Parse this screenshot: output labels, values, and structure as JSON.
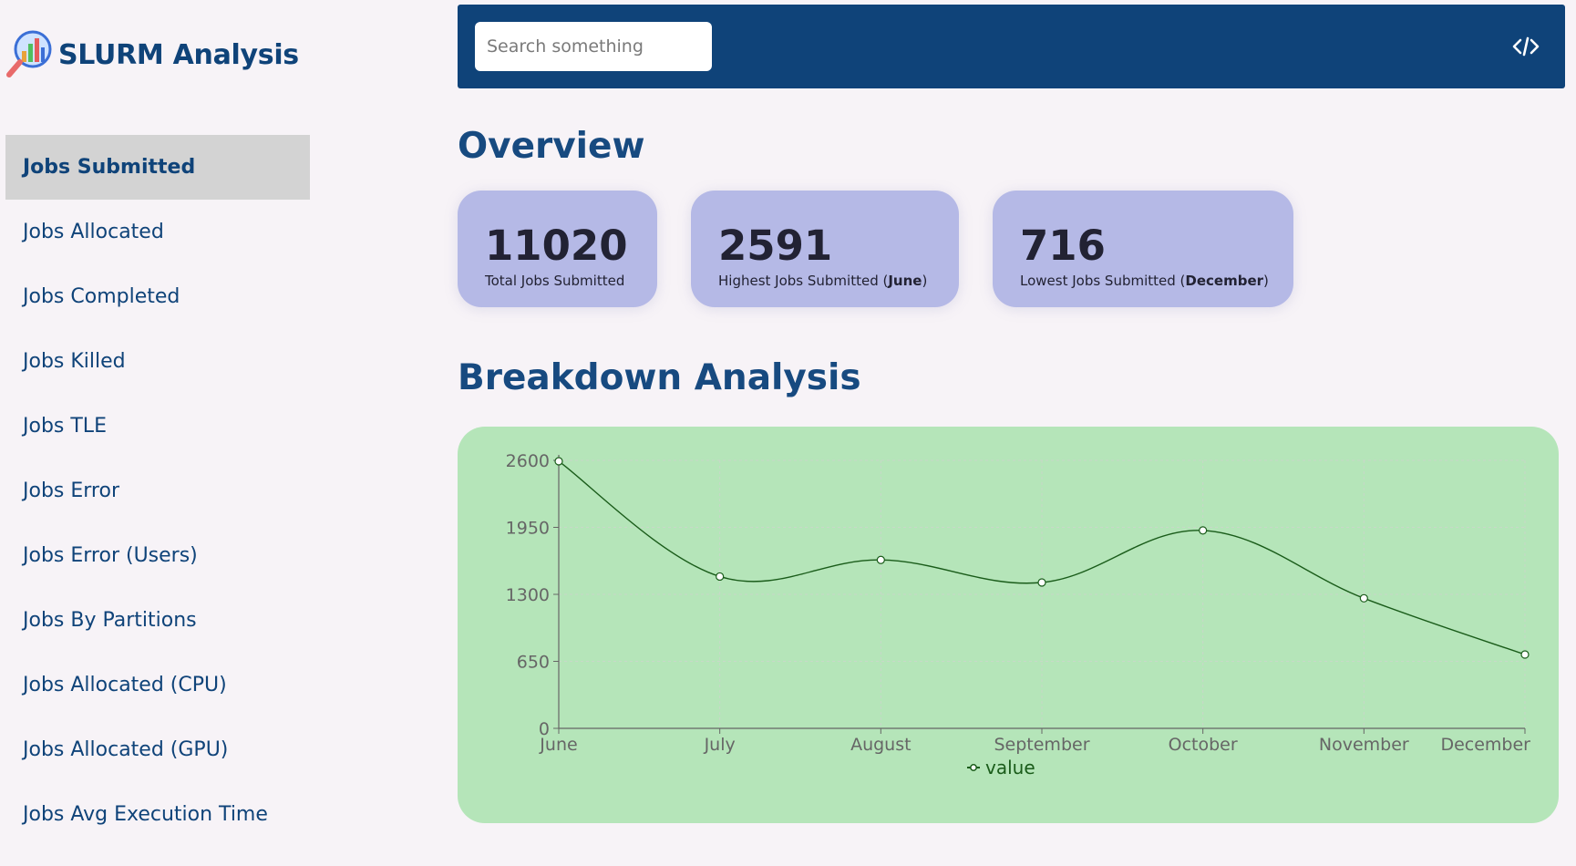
{
  "app": {
    "title": "SLURM Analysis",
    "logo_icon": "analytics-magnifier-icon"
  },
  "sidebar": {
    "items": [
      {
        "label": "Jobs Submitted",
        "active": true
      },
      {
        "label": "Jobs Allocated"
      },
      {
        "label": "Jobs Completed"
      },
      {
        "label": "Jobs Killed"
      },
      {
        "label": "Jobs TLE"
      },
      {
        "label": "Jobs Error"
      },
      {
        "label": "Jobs Error (Users)"
      },
      {
        "label": "Jobs By Partitions"
      },
      {
        "label": "Jobs Allocated (CPU)"
      },
      {
        "label": "Jobs Allocated (GPU)"
      },
      {
        "label": "Jobs Avg Execution Time"
      }
    ]
  },
  "header": {
    "search_placeholder": "Search something",
    "code_icon": "code-icon"
  },
  "overview": {
    "title": "Overview",
    "cards": [
      {
        "value": "11020",
        "label": "Total Jobs Submitted",
        "label_emph": ""
      },
      {
        "value": "2591",
        "label": "Highest Jobs Submitted",
        "label_emph": "June"
      },
      {
        "value": "716",
        "label": "Lowest Jobs Submitted",
        "label_emph": "December"
      }
    ]
  },
  "breakdown": {
    "title": "Breakdown Analysis"
  },
  "colors": {
    "brand": "#0f4379",
    "card_bg": "#b5b9e6",
    "chart_bg": "#b5e5b9",
    "line": "#1a5c1a"
  },
  "chart_data": {
    "type": "line",
    "categories": [
      "June",
      "July",
      "August",
      "September",
      "October",
      "November",
      "December"
    ],
    "series": [
      {
        "name": "value",
        "values": [
          2591,
          1473,
          1634,
          1415,
          1920,
          1262,
          716
        ]
      }
    ],
    "ylim": [
      0,
      2600
    ],
    "yticks": [
      0,
      650,
      1300,
      1950,
      2600
    ],
    "grid": true,
    "legend": "bottom-center",
    "curve": "smooth"
  }
}
